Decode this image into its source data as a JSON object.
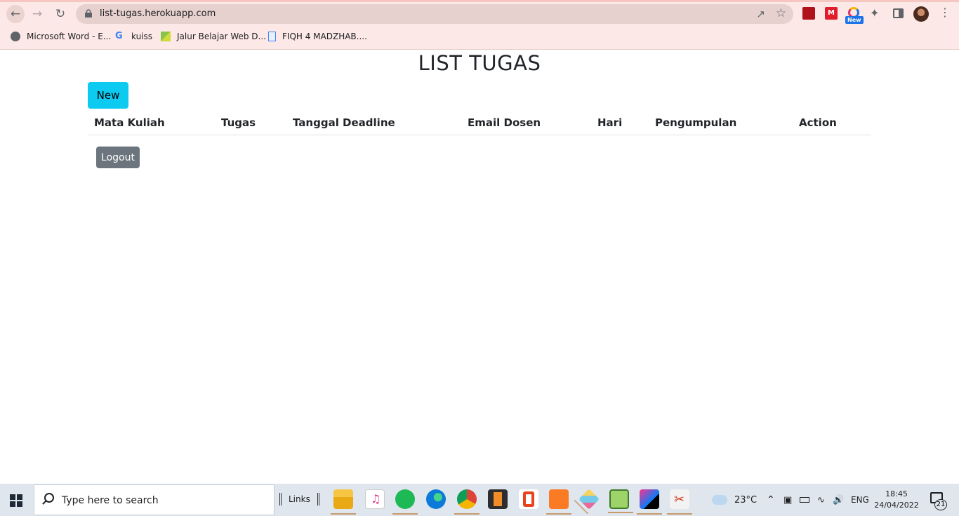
{
  "browser": {
    "url": "list-tugas.herokuapp.com",
    "new_badge": "New",
    "bookmarks": [
      {
        "label": "Microsoft Word - E..."
      },
      {
        "label": "kuiss"
      },
      {
        "label": "Jalur Belajar Web D..."
      },
      {
        "label": "FIQH 4 MADZHAB...."
      }
    ]
  },
  "page": {
    "title": "LIST TUGAS",
    "new_button": "New",
    "logout_button": "Logout",
    "table_headers": [
      "Mata Kuliah",
      "Tugas",
      "Tanggal Deadline",
      "Email Dosen",
      "Hari",
      "Pengumpulan",
      "Action"
    ],
    "rows": []
  },
  "taskbar": {
    "search_placeholder": "Type here to search",
    "links_label": "Links",
    "apps": [
      "file-explorer",
      "itunes",
      "spotify",
      "edge",
      "chrome",
      "sublime-text",
      "office",
      "xampp",
      "git-kraken",
      "notepad",
      "intellij",
      "snipping-tool"
    ],
    "weather": "23°C",
    "language": "ENG",
    "time": "18:45",
    "date": "24/04/2022",
    "notification_count": "21"
  },
  "colors": {
    "chrome_bg": "#fce8e6",
    "new_button": "#0dcaf0",
    "logout_button": "#6c757d",
    "taskbar_bg": "#dfe6ee"
  }
}
